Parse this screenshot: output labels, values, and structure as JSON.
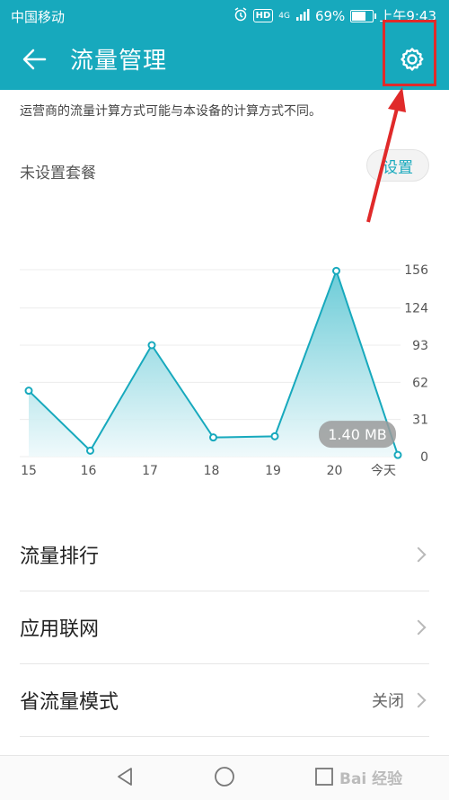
{
  "status_bar": {
    "carrier": "中国移动",
    "network": "4G",
    "hd": "HD",
    "battery": "69%",
    "battery_level": 0.69,
    "time": "上午9:43"
  },
  "header": {
    "title": "流量管理",
    "back_icon": "back-arrow-icon",
    "settings_icon": "gear-icon"
  },
  "notice": "运营商的流量计算方式可能与本设备的计算方式不同。",
  "plan": {
    "label": "未设置套餐",
    "button": "设置"
  },
  "chart_data": {
    "type": "area",
    "x": [
      "15",
      "16",
      "17",
      "18",
      "19",
      "20",
      "今天"
    ],
    "values": [
      55,
      5,
      93,
      16,
      17,
      155,
      1.4
    ],
    "yticks": [
      0,
      31,
      62,
      93,
      124,
      156
    ],
    "ylim": [
      0,
      156
    ],
    "tooltip": "1.40 MB",
    "colors": {
      "line": "#17a9bd",
      "fill_top": "#5cc6d3",
      "fill_bottom": "#eef9fb"
    }
  },
  "list": [
    {
      "label": "流量排行",
      "value": ""
    },
    {
      "label": "应用联网",
      "value": ""
    },
    {
      "label": "省流量模式",
      "value": "关闭"
    }
  ],
  "nav": {
    "back": "nav-back-icon",
    "home": "nav-home-icon",
    "recents": "nav-recents-icon"
  },
  "watermark": "Bai 经验"
}
